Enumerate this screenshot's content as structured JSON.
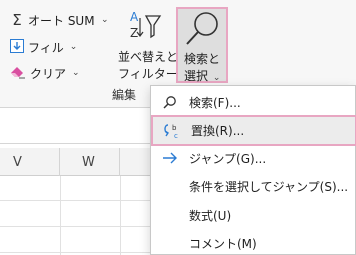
{
  "ribbon": {
    "autosum_label": "オート SUM",
    "fill_label": "フィル",
    "clear_label": "クリア",
    "sort_filter_line1": "並べ替えと",
    "sort_filter_line2": "フィルター",
    "find_select_line1": "検索と",
    "find_select_line2": "選択",
    "group_label": "編集",
    "colors": {
      "highlight_border": "#e8a6c2",
      "accent_blue": "#2b7cd3"
    }
  },
  "sheet": {
    "columns": [
      "V",
      "W"
    ]
  },
  "menu": {
    "items": [
      {
        "label": "検索(F)...",
        "icon": "search-icon"
      },
      {
        "label": "置換(R)...",
        "icon": "replace-icon",
        "highlighted": true
      },
      {
        "label": "ジャンプ(G)...",
        "icon": "arrow-right-icon"
      },
      {
        "label": "条件を選択してジャンプ(S)...",
        "icon": ""
      },
      {
        "label": "数式(U)",
        "icon": ""
      },
      {
        "label": "コメント(M)",
        "icon": ""
      }
    ]
  }
}
